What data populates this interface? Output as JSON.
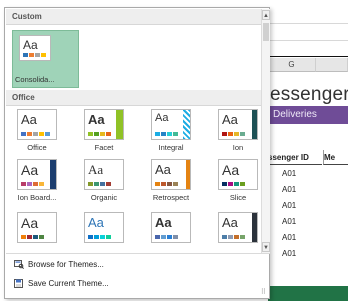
{
  "spreadsheet": {
    "column_g": "G",
    "title_fragment": "essenger",
    "subtitle_fragment": "Deliveries",
    "header_id": "ssenger ID",
    "header_next": "Me",
    "cells": [
      "A01",
      "A01",
      "A01",
      "A01",
      "A01",
      "A01"
    ],
    "colors": {
      "purple": "#6f4c97",
      "status_green": "#217346"
    }
  },
  "themes_panel": {
    "custom_header": "Custom",
    "custom_theme": {
      "name": "Consolida...",
      "aa": "Aa"
    },
    "office_header": "Office",
    "office_themes": [
      {
        "name": "Office",
        "aa": "Aa"
      },
      {
        "name": "Facet",
        "aa": "Aa"
      },
      {
        "name": "Integral",
        "aa": "Aa"
      },
      {
        "name": "Ion",
        "aa": "Aa"
      },
      {
        "name": "Ion Board...",
        "aa": "Aa"
      },
      {
        "name": "Organic",
        "aa": "Aa"
      },
      {
        "name": "Retrospect",
        "aa": "Aa"
      },
      {
        "name": "Slice",
        "aa": "Aa"
      },
      {
        "name": "",
        "aa": "Aa"
      },
      {
        "name": "",
        "aa": "Aa"
      },
      {
        "name": "",
        "aa": "Aa"
      },
      {
        "name": "",
        "aa": "Aa"
      }
    ],
    "browse_label": "Browse for Themes...",
    "save_label": "Save Current Theme...",
    "selection_color": "#9fd3b8"
  }
}
